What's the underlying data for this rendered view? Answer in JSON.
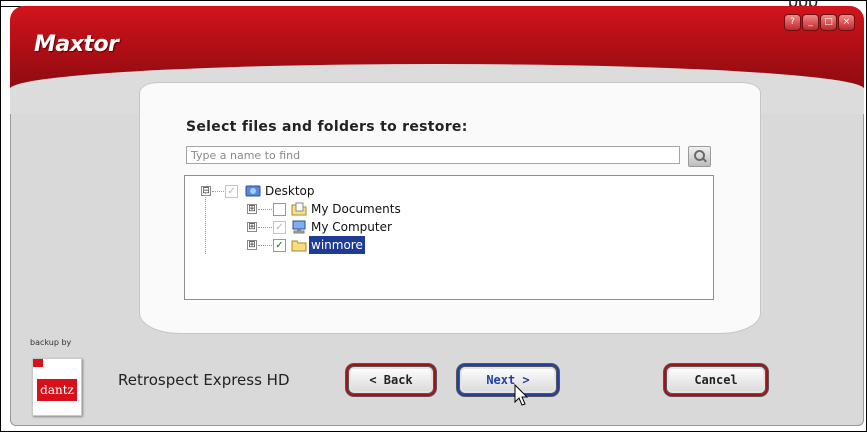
{
  "corner_text": "ppp",
  "window": {
    "logo": "Maxtor",
    "controls": [
      "?",
      "_",
      "□",
      "×"
    ]
  },
  "restore": {
    "heading": "Select files and folders to restore:",
    "search_placeholder": "Type a name to find",
    "tree": {
      "root": {
        "label": "Desktop",
        "expander": "⊟",
        "checked": false,
        "partial": true
      },
      "children": [
        {
          "label": "My Documents",
          "expander": "⊞",
          "checked": false,
          "partial": false
        },
        {
          "label": "My Computer",
          "expander": "⊞",
          "checked": false,
          "partial": true
        },
        {
          "label": "winmore",
          "expander": "⊞",
          "checked": true,
          "selected": true
        }
      ]
    }
  },
  "footer": {
    "backup_by": "backup by",
    "dantz": "dantz",
    "product": "Retrospect Express HD",
    "buttons": {
      "back": "< Back",
      "next": "Next >",
      "cancel": "Cancel"
    }
  },
  "colors": {
    "brand_red": "#c0141b",
    "selection": "#1e3b96"
  }
}
